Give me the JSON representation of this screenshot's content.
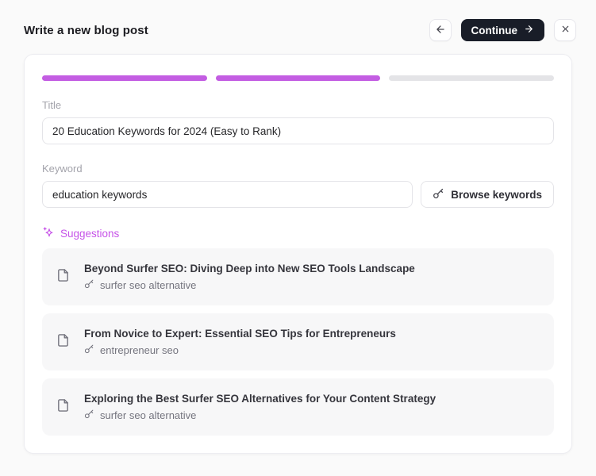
{
  "header": {
    "title": "Write a new blog post",
    "back_icon": "arrow-left-icon",
    "continue_label": "Continue",
    "continue_icon": "arrow-right-icon",
    "close_icon": "close-icon"
  },
  "colors": {
    "accent_purple": "#c35de2",
    "suggestions_purple": "#c653e8",
    "progress_track": "#e4e4e7",
    "dark_button": "#191d28"
  },
  "progress": {
    "total_steps": 3,
    "completed_steps": 2
  },
  "title_field": {
    "label": "Title",
    "value": "20 Education Keywords for 2024 (Easy to Rank)"
  },
  "keyword_field": {
    "label": "Keyword",
    "value": "education keywords"
  },
  "browse_button": {
    "label": "Browse keywords",
    "icon": "key-icon"
  },
  "suggestions": {
    "label": "Suggestions",
    "icon": "sparkles-icon",
    "items": [
      {
        "icon": "file-icon",
        "keyword_icon": "key-icon",
        "title": "Beyond Surfer SEO: Diving Deep into New SEO Tools Landscape",
        "keyword": "surfer seo alternative"
      },
      {
        "icon": "file-icon",
        "keyword_icon": "key-icon",
        "title": "From Novice to Expert: Essential SEO Tips for Entrepreneurs",
        "keyword": "entrepreneur seo"
      },
      {
        "icon": "file-icon",
        "keyword_icon": "key-icon",
        "title": "Exploring the Best Surfer SEO Alternatives for Your Content Strategy",
        "keyword": "surfer seo alternative"
      }
    ]
  }
}
